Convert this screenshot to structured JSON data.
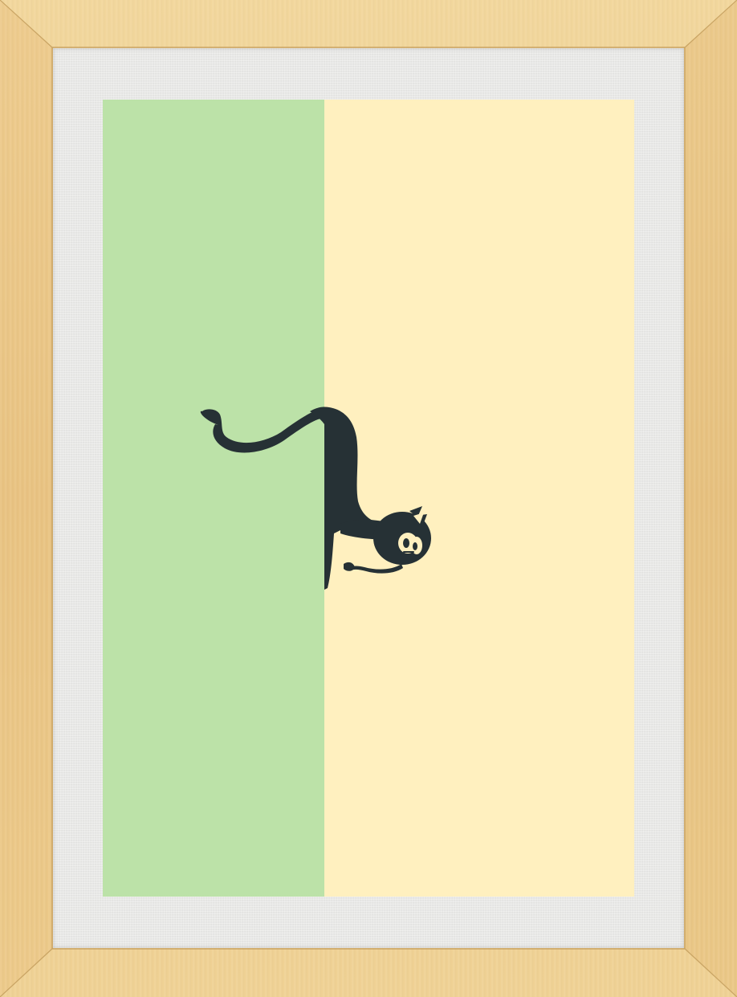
{
  "artwork": {
    "subject": "cat-peeking-around-wall",
    "colors": {
      "frame": "#ecc98a",
      "mat": "#e6e6e4",
      "left_panel": "#bce2a8",
      "right_panel": "#fff0bf",
      "cat": "#263135"
    }
  }
}
